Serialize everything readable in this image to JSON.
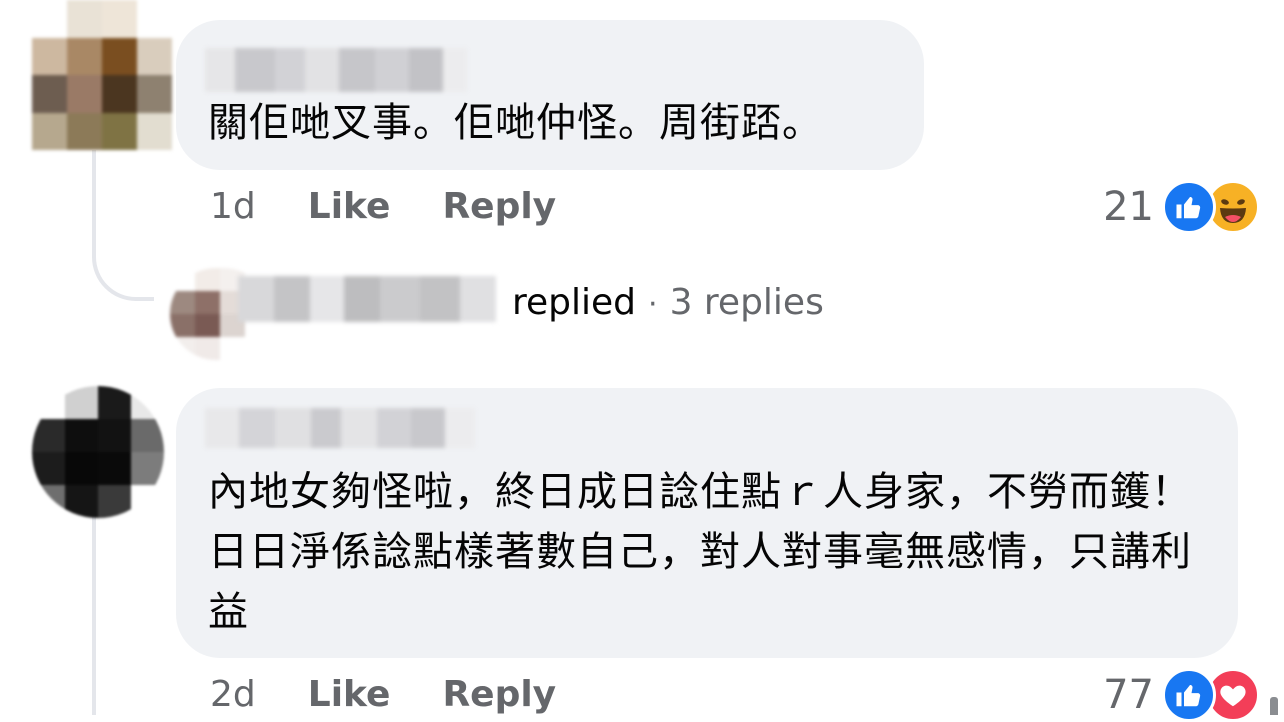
{
  "comments": [
    {
      "text": "關佢哋叉事。佢哋仲怪。周街踎。",
      "time": "1d",
      "like_label": "Like",
      "reply_label": "Reply",
      "reaction_count": "21",
      "reactions": [
        "like-icon",
        "haha-icon"
      ]
    },
    {
      "text": "內地女夠怪啦，終日成日諗住點ｒ人身家，不勞而鑊！日日淨係諗點樣著數自己，對人對事毫無感情，只講利益",
      "time": "2d",
      "like_label": "Like",
      "reply_label": "Reply",
      "reaction_count": "77",
      "reactions": [
        "like-icon",
        "love-icon"
      ]
    }
  ],
  "replies_summary": {
    "replied_suffix": "replied",
    "separator": "·",
    "count_label": "3 replies"
  },
  "colors": {
    "bubble": "#f0f2f5",
    "meta_text": "#65676b",
    "like_blue": "#1877f2",
    "haha_yellow": "#f7b125",
    "love_red": "#f33e58"
  }
}
